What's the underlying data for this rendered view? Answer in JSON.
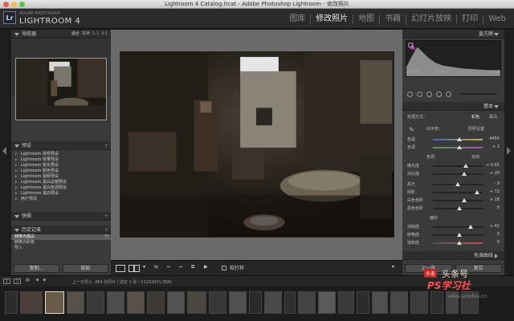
{
  "window": {
    "title": "Lightroom 4 Catalog.lrcat - Adobe Photoshop Lightroom - 修改照片"
  },
  "header": {
    "adobe_label": "ADOBE PHOTOSHOP",
    "product_label": "LIGHTROOM 4",
    "logo": "Lr",
    "modules": [
      "图库",
      "修改照片",
      "地图",
      "书籍",
      "幻灯片放映",
      "打印",
      "Web"
    ],
    "active_module": "修改照片"
  },
  "left_panel": {
    "navigator": {
      "title": "导航器",
      "zoom_options": [
        "适合",
        "填满",
        "1:1",
        "3:1"
      ]
    },
    "presets": {
      "title": "预设",
      "items": [
        "Lightroom 常规预设",
        "Lightroom 效果预设",
        "Lightroom 锐化预设",
        "Lightroom 颜色预设",
        "Lightroom 视频预设",
        "Lightroom 黑白滤镜预设",
        "Lightroom 黑白色调预设",
        "Lightroom 黑白预设",
        "用户预设"
      ]
    },
    "snapshots": {
      "title": "快照"
    },
    "history": {
      "title": "历史记录",
      "items": [
        {
          "label": "转换为黑白",
          "num": "开"
        },
        {
          "label": "转换为彩色",
          "num": ""
        },
        {
          "label": "导入",
          "num": ""
        }
      ]
    },
    "copy_button": "复制...",
    "paste_button": "粘贴"
  },
  "toolbar": {
    "soft_proof": "软打样"
  },
  "right_panel": {
    "histogram": {
      "title": "直方图",
      "iso": "ISO 250",
      "focal": "21 mm",
      "aperture": "f / 7.2",
      "shutter": "1/60 秒"
    },
    "basic": {
      "title": "基本",
      "treatment_label": "处理方式：",
      "treatment_color": "彩色",
      "treatment_bw": "黑白",
      "wb_label": "白平衡：",
      "wb_value": "原照设置",
      "sliders": [
        {
          "label": "色温",
          "value": "4450"
        },
        {
          "label": "色调",
          "value": "+ 1"
        },
        {
          "label": "色调",
          "value": "自动"
        },
        {
          "label": "曝光度",
          "value": "+ 0.65"
        },
        {
          "label": "对比度",
          "value": "+ 20"
        },
        {
          "label": "高光",
          "value": "- 9"
        },
        {
          "label": "阴影",
          "value": "+ 72"
        },
        {
          "label": "白色色阶",
          "value": "+ 18"
        },
        {
          "label": "黑色色阶",
          "value": "0"
        },
        {
          "label": "偏好",
          "value": ""
        },
        {
          "label": "清晰度",
          "value": "+ 42"
        },
        {
          "label": "鲜艳度",
          "value": "0"
        },
        {
          "label": "饱和度",
          "value": "0"
        }
      ]
    },
    "tone_curve": {
      "title": "色调曲线"
    },
    "prev_button": "上一张",
    "reset_button": "复位"
  },
  "filmstrip": {
    "nav_text": "上一次导入",
    "info_text": "364 张照片 / 选定 1 张 / 13102931.DNG",
    "page_nums": [
      "1",
      "2"
    ]
  },
  "watermark": {
    "line1": "头条号",
    "line2": "PS学习社",
    "badge": "头条",
    "url": "www.szoxfeu.cn"
  }
}
